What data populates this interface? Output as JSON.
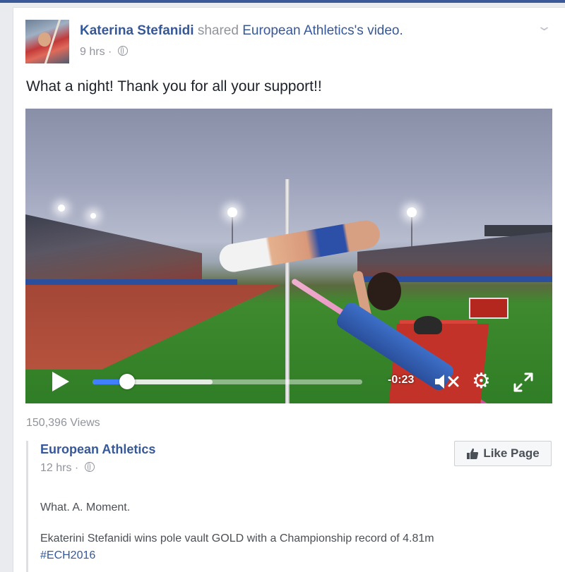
{
  "post": {
    "author": "Katerina Stefanidi",
    "action": "shared",
    "shared_source": "European Athletics's video.",
    "time": "9 hrs",
    "separator": "·",
    "message": "What a night! Thank you for all your support!!",
    "audience_icon": "globe-icon",
    "menu_icon": "chevron-down-icon"
  },
  "video": {
    "remaining_time": "-0:23",
    "progress_fraction": 0.1,
    "buffered_fraction": 0.45,
    "icons": [
      "play-icon",
      "mute-icon",
      "gear-icon",
      "fullscreen-icon"
    ],
    "accent_color": "#4080ff"
  },
  "stats": {
    "views": "150,396 Views"
  },
  "shared_post": {
    "page_name": "European Athletics",
    "time": "12 hrs",
    "separator": "·",
    "like_button": "Like Page",
    "text1": "What. A. Moment.",
    "text2": "Ekaterini Stefanidi wins pole vault GOLD with a Championship record of 4.81m",
    "hashtag": "#ECH2016"
  }
}
